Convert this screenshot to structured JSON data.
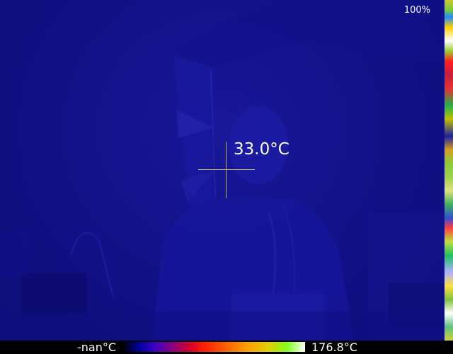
{
  "status": {
    "battery_text": "100%"
  },
  "measurement": {
    "spot_temperature": "33.0°C"
  },
  "color_scale": {
    "min_label": "-nan°C",
    "max_label": "176.8°C"
  },
  "colors": {
    "background": "#12128a",
    "crosshair": "#b9b45a",
    "text": "#ffffff"
  },
  "icons": {
    "crosshair": "crosshair-icon"
  }
}
